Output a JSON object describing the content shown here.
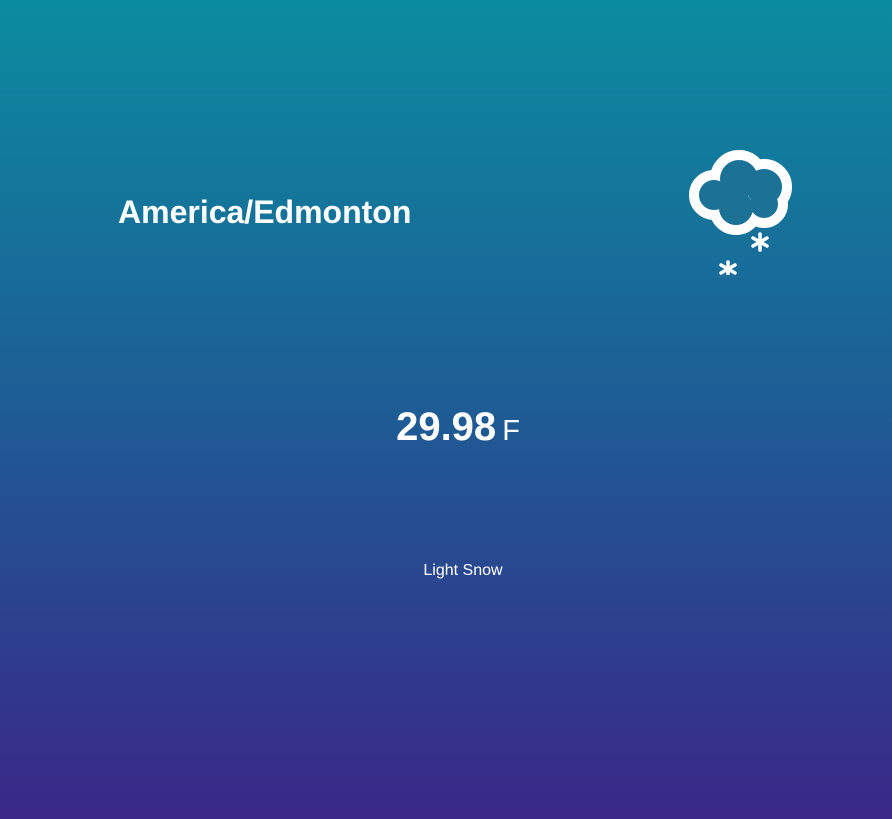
{
  "location": {
    "timezone": "America/Edmonton"
  },
  "current": {
    "temperature": "29.98",
    "unit": "F",
    "description": "Light Snow",
    "icon": "cloud-snow-icon"
  },
  "theme": {
    "gradient_top": "#0b8ca0",
    "gradient_middle": "#1e5c95",
    "gradient_bottom": "#3a2788",
    "text_color": "#ffffff"
  }
}
